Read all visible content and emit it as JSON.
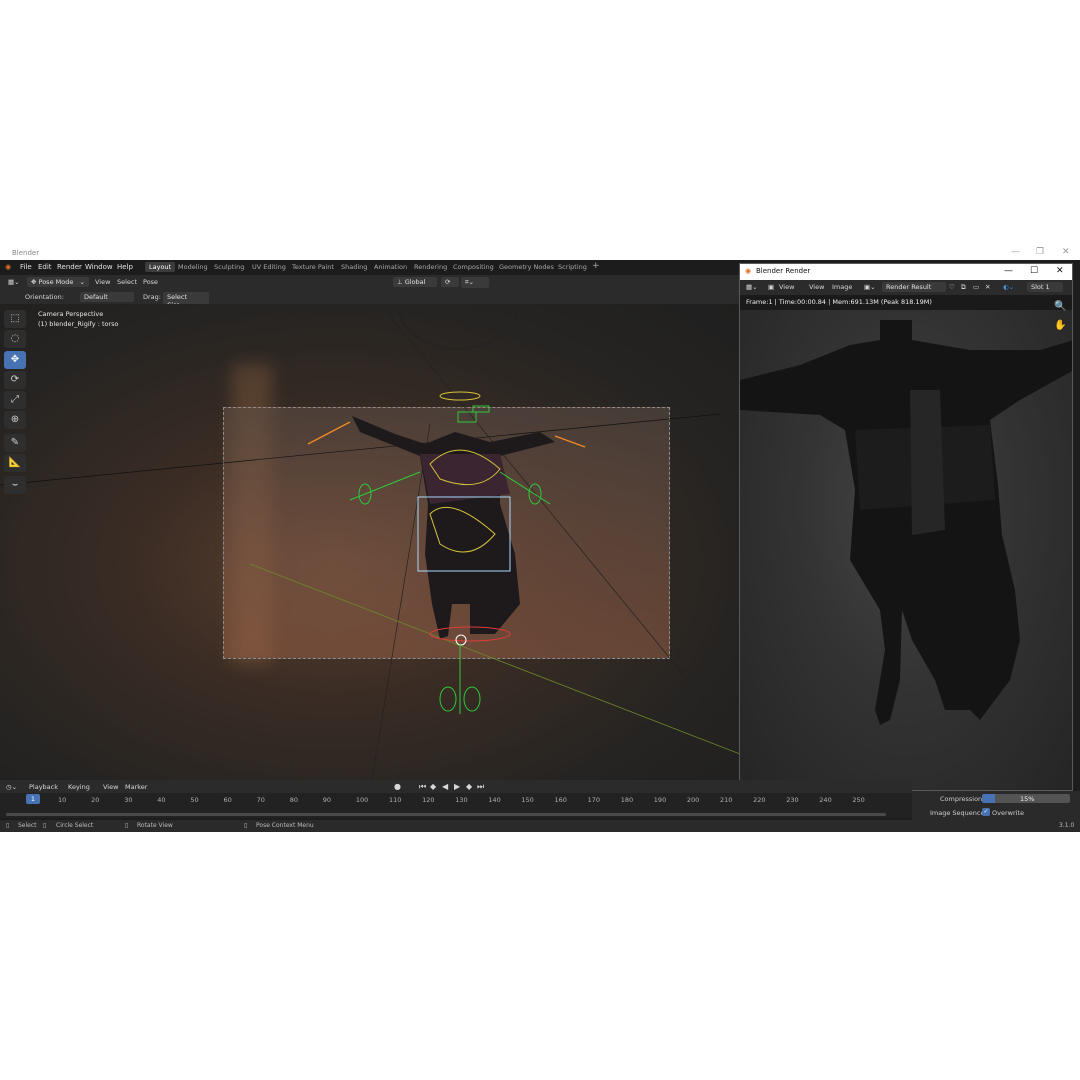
{
  "window": {
    "title": "Blender",
    "controls": [
      "—",
      "❐",
      "✕"
    ]
  },
  "menu": [
    "File",
    "Edit",
    "Render",
    "Window",
    "Help"
  ],
  "workspaces": {
    "active": "Layout",
    "tabs": [
      "Layout",
      "Modeling",
      "Sculpting",
      "UV Editing",
      "Texture Paint",
      "Shading",
      "Animation",
      "Rendering",
      "Compositing",
      "Geometry Nodes",
      "Scripting",
      "+"
    ]
  },
  "header": {
    "mode": "Pose Mode",
    "menus": [
      "View",
      "Select",
      "Pose"
    ],
    "transform_orientation": "Global",
    "orientation_label": "Orientation:",
    "orientation_value": "Default",
    "drag_label": "Drag:",
    "drag_value": "Select Circ..."
  },
  "viewport": {
    "info_line1": "Camera Perspective",
    "info_line2": "(1) blender_Rigify : torso"
  },
  "tools": [
    "tweak-icon",
    "select-circle-icon",
    "move-icon",
    "rotate-icon",
    "scale-icon",
    "transform-icon",
    "annotate-icon",
    "measure-icon",
    "relax-pose-icon"
  ],
  "timeline": {
    "menus": [
      "Playback",
      "Keying",
      "View",
      "Marker"
    ],
    "current_frame": "1",
    "ticks": [
      "10",
      "20",
      "30",
      "40",
      "50",
      "60",
      "70",
      "80",
      "90",
      "100",
      "110",
      "120",
      "130",
      "140",
      "150",
      "160",
      "170",
      "180",
      "190",
      "200",
      "210",
      "220",
      "230",
      "240",
      "250"
    ]
  },
  "statusbar": {
    "select": "Select",
    "circle_select": "Circle Select",
    "rotate_view": "Rotate View",
    "context_menu": "Pose Context Menu",
    "version": "3.1.0"
  },
  "render_window": {
    "title": "Blender Render",
    "controls": [
      "—",
      "☐",
      "✕"
    ],
    "menus": [
      "View",
      "View",
      "Image"
    ],
    "image_name": "Render Result",
    "slot": "Slot 1",
    "info": "Frame:1 | Time:00:00.84 | Mem:691.13M (Peak 818.19M)"
  },
  "output_panel": {
    "compression_label": "Compression",
    "compression_value": "15%",
    "compression_fraction": 0.15,
    "image_sequence_label": "Image Sequence",
    "overwrite_label": "Overwrite"
  },
  "colors": {
    "accent": "#4772b3",
    "bg": "#1d1d1d"
  }
}
